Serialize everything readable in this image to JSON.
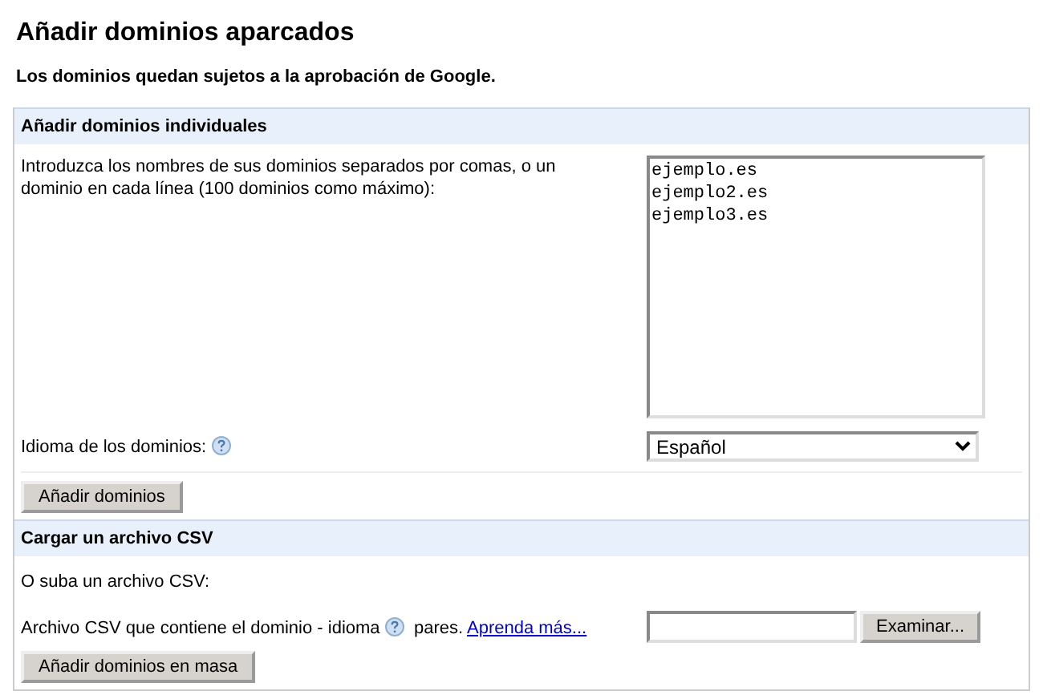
{
  "title": "Añadir dominios aparcados",
  "subtitle": "Los dominios quedan sujetos a la aprobación de Google.",
  "individual": {
    "heading": "Añadir dominios individuales",
    "instructions": "Introduzca los nombres de sus dominios separados por comas, o un dominio en cada línea (100 dominios como máximo):",
    "domains": [
      "ejemplo.es",
      "ejemplo2.es",
      "ejemplo3.es"
    ],
    "language_label": "Idioma de los dominios:",
    "language": "Español",
    "button": "Añadir dominios"
  },
  "csv": {
    "heading": "Cargar un archivo CSV",
    "intro": "O suba un archivo CSV:",
    "file_label": "Archivo CSV que contiene el dominio - idioma",
    "file_label_after": "pares.",
    "link": "Aprenda más...",
    "browse_button": "Examinar...",
    "button": "Añadir dominios en masa"
  }
}
